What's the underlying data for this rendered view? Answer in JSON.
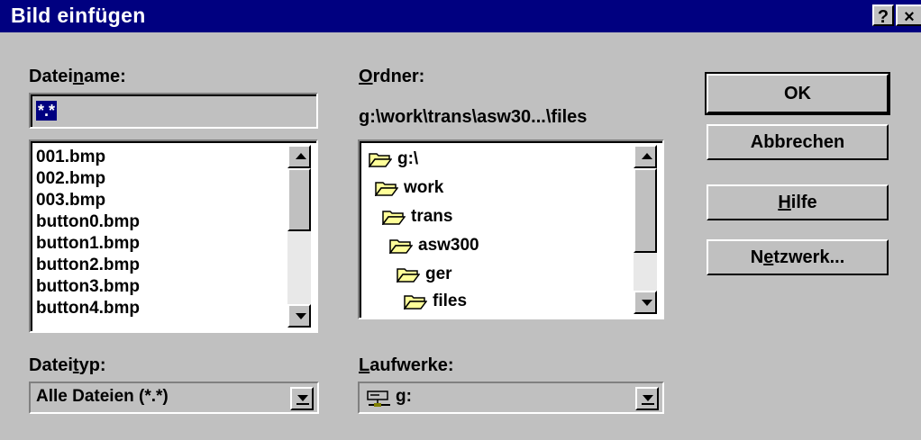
{
  "window": {
    "title": "Bild einfügen",
    "help_button": "?",
    "close_button": "×"
  },
  "filename": {
    "label_pre": "Datei",
    "label_accel": "n",
    "label_post": "ame:",
    "value": "*.*"
  },
  "files": [
    "001.bmp",
    "002.bmp",
    "003.bmp",
    "button0.bmp",
    "button1.bmp",
    "button2.bmp",
    "button3.bmp",
    "button4.bmp"
  ],
  "folder": {
    "label_accel": "O",
    "label_post": "rdner:",
    "path": "g:\\work\\trans\\asw30...\\files"
  },
  "tree": [
    "g:\\",
    "work",
    "trans",
    "asw300",
    "ger",
    "files"
  ],
  "filetype": {
    "label_pre": "Datei",
    "label_accel": "t",
    "label_post": "yp:",
    "value": "Alle Dateien (*.*)"
  },
  "drives": {
    "label_accel": "L",
    "label_post": "aufwerke:",
    "value": "g:"
  },
  "buttons": {
    "ok": "OK",
    "cancel": "Abbrechen",
    "help_accel": "H",
    "help_post": "ilfe",
    "network_pre": "N",
    "network_accel": "e",
    "network_post": "tzwerk..."
  },
  "icons": {
    "folder": "folder-open-icon",
    "drive": "network-drive-icon"
  },
  "colors": {
    "titlebar": "#000080",
    "face": "#c0c0c0",
    "selection": "#000080",
    "folder": "#ffff99"
  }
}
